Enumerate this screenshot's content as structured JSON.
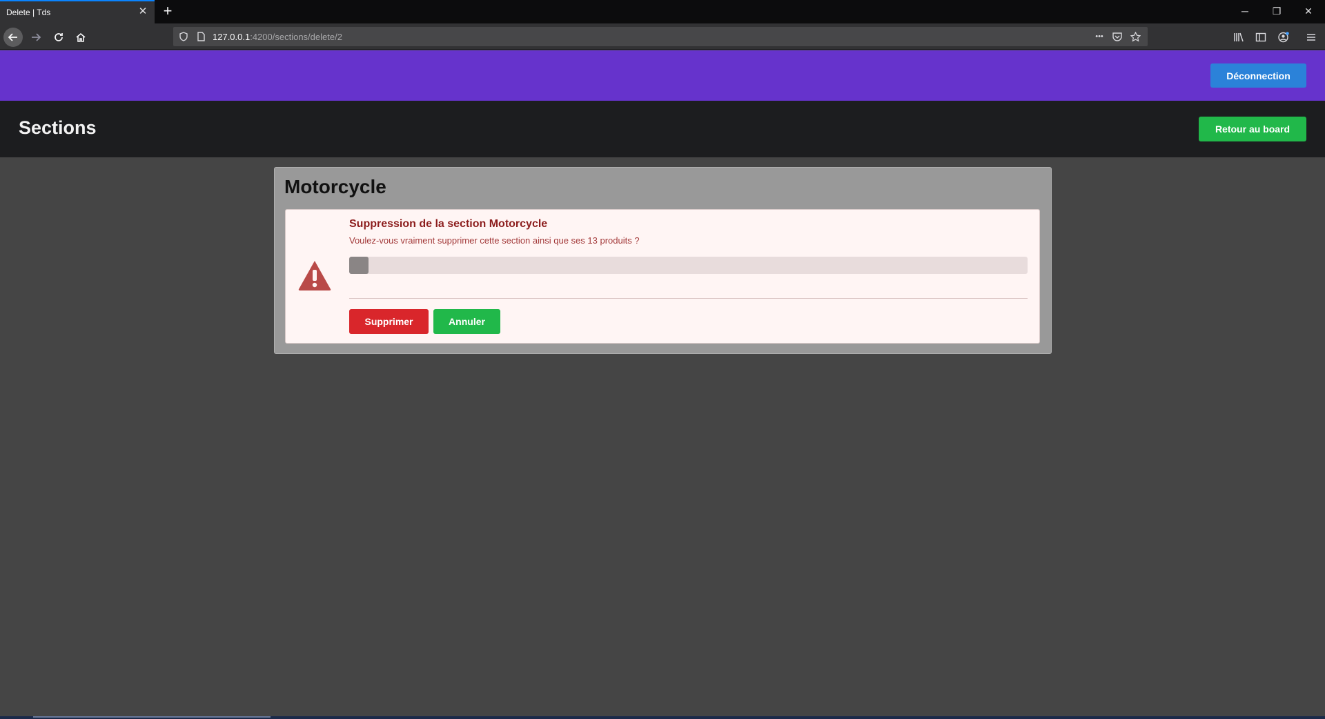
{
  "browser": {
    "tab_title": "Delete | Tds",
    "url_host": "127.0.0.1",
    "url_path": ":4200/sections/delete/2",
    "url_more": "•••"
  },
  "header": {
    "logout_label": "Déconnection",
    "logout_color": "#2b82d9",
    "bar_color": "#6633cc"
  },
  "subheader": {
    "title": "Sections",
    "back_label": "Retour au board"
  },
  "card": {
    "title": "Motorcycle",
    "alert": {
      "heading": "Suppression de la section Motorcycle",
      "message": "Voulez-vous vraiment supprimer cette section ainsi que ses 13 produits ?",
      "progress_fraction": 0.028,
      "delete_label": "Supprimer",
      "cancel_label": "Annuler"
    }
  },
  "colors": {
    "danger": "#d9262b",
    "success": "#21b84a"
  }
}
